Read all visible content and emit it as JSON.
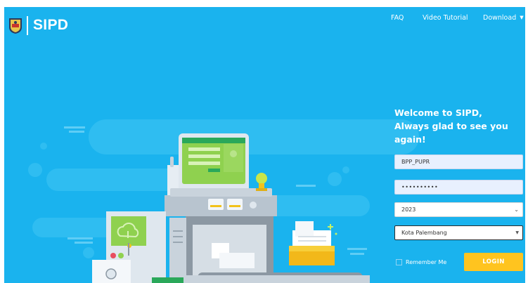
{
  "app": {
    "brand": "SIPD"
  },
  "nav": {
    "faq": "FAQ",
    "video_tutorial": "Video Tutorial",
    "download": "Download"
  },
  "welcome": {
    "line1_prefix": "Welcome to ",
    "line1_brand": "SIPD",
    "line1_suffix": ",",
    "line2": "Always glad to see you again!"
  },
  "form": {
    "username": "BPP_PUPR",
    "password": "••••••••••",
    "year": "2023",
    "region": "Kota Palembang",
    "remember_label": "Remember Me",
    "login_label": "LOGIN"
  },
  "colors": {
    "background": "#1ab3ee",
    "accent": "#ffc41f",
    "screen_green": "#8fd14f"
  }
}
